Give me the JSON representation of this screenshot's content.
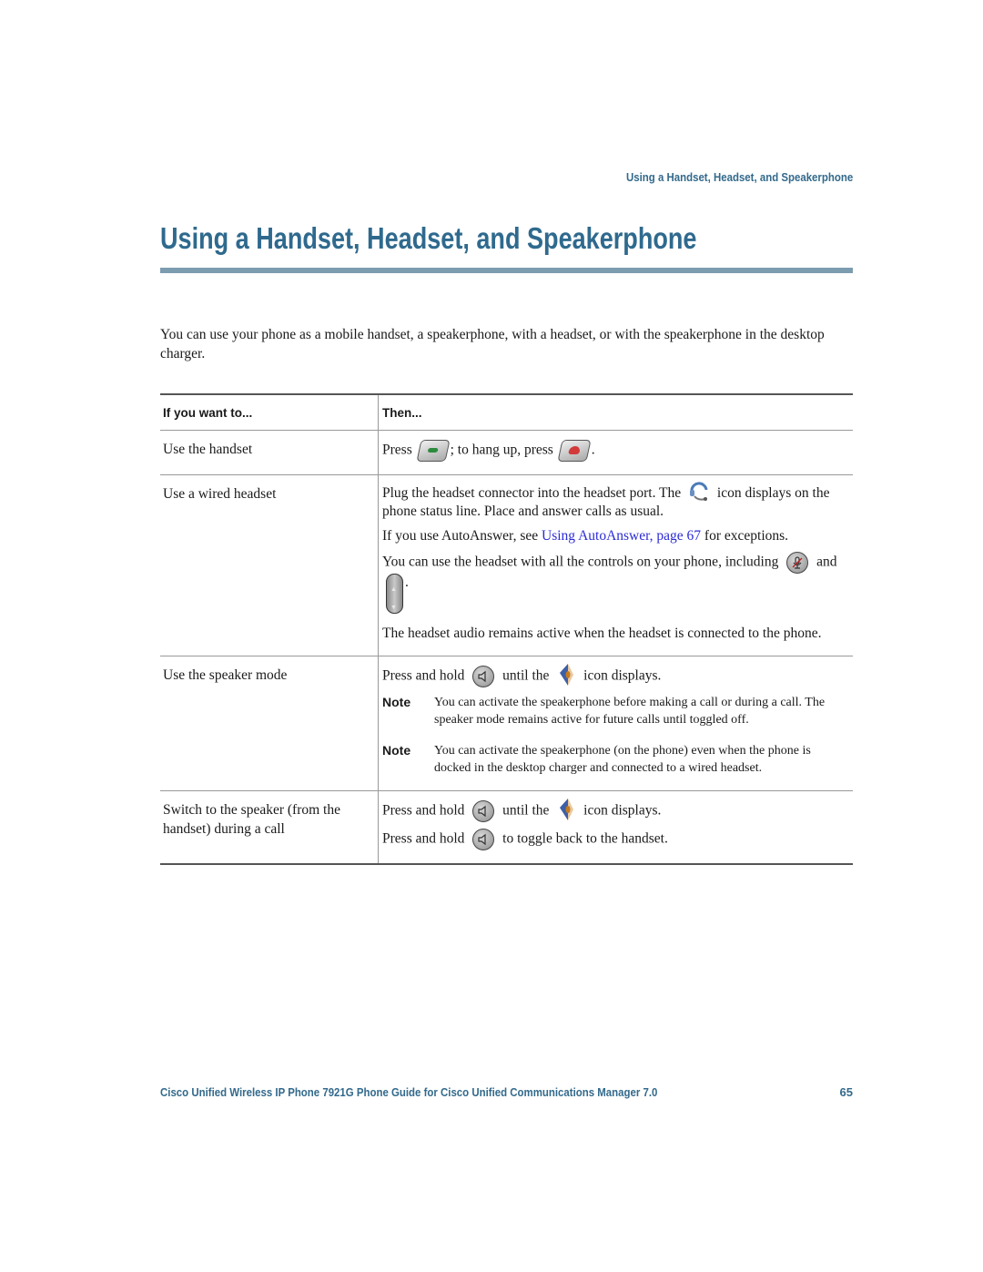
{
  "running_header": "Using a Handset, Headset, and Speakerphone",
  "page_title": "Using a Handset, Headset, and Speakerphone",
  "intro": "You can use your phone as a mobile handset, a speakerphone, with a headset, or with the speakerphone in the desktop charger.",
  "table": {
    "headers": [
      "If you want to...",
      "Then..."
    ],
    "rows": [
      {
        "action": "Use the handset",
        "then": {
          "press": "Press",
          "hang_up": "; to hang up, press",
          "end": ".",
          "icons": [
            "send-key-icon",
            "end-key-icon"
          ]
        }
      },
      {
        "action": "Use a wired headset",
        "then": {
          "p1_a": "Plug the headset connector into the headset port. The",
          "p1_b": "icon displays on the phone status line. Place and answer calls as usual.",
          "p2_a": "If you use AutoAnswer, see",
          "p2_link": "Using AutoAnswer, page 67",
          "p2_b": "for exceptions.",
          "p3_a": "You can use the headset with all the controls on your phone, including",
          "p3_and": "and",
          "p3_end": ".",
          "p4": "The headset audio remains active when the headset is connected to the phone.",
          "icons": [
            "headset-icon",
            "mute-key-icon",
            "volume-key-icon"
          ]
        }
      },
      {
        "action": "Use the speaker mode",
        "then": {
          "p1_a": "Press and hold",
          "p1_b": "until the",
          "p1_c": "icon displays.",
          "notes": [
            {
              "label": "Note",
              "text": "You can activate the speakerphone before making a call or during a call. The speaker mode remains active for future calls until toggled off."
            },
            {
              "label": "Note",
              "text": "You can activate the speakerphone (on the phone) even when the phone is docked in the desktop charger and connected to a wired headset."
            }
          ],
          "icons": [
            "speaker-key-icon",
            "speaker-status-icon"
          ]
        }
      },
      {
        "action": "Switch to the speaker (from the handset) during a call",
        "then": {
          "p1_a": "Press and hold",
          "p1_b": "until the",
          "p1_c": "icon displays.",
          "p2_a": "Press and hold",
          "p2_b": "to toggle back to the handset.",
          "icons": [
            "speaker-key-icon",
            "speaker-status-icon"
          ]
        }
      }
    ]
  },
  "footer": {
    "title": "Cisco Unified Wireless IP Phone 7921G Phone Guide for Cisco Unified Communications Manager 7.0",
    "page_number": "65"
  },
  "colors": {
    "heading": "#2f6a8e",
    "rule": "#7c9cb0",
    "link": "#2b2bd6"
  }
}
